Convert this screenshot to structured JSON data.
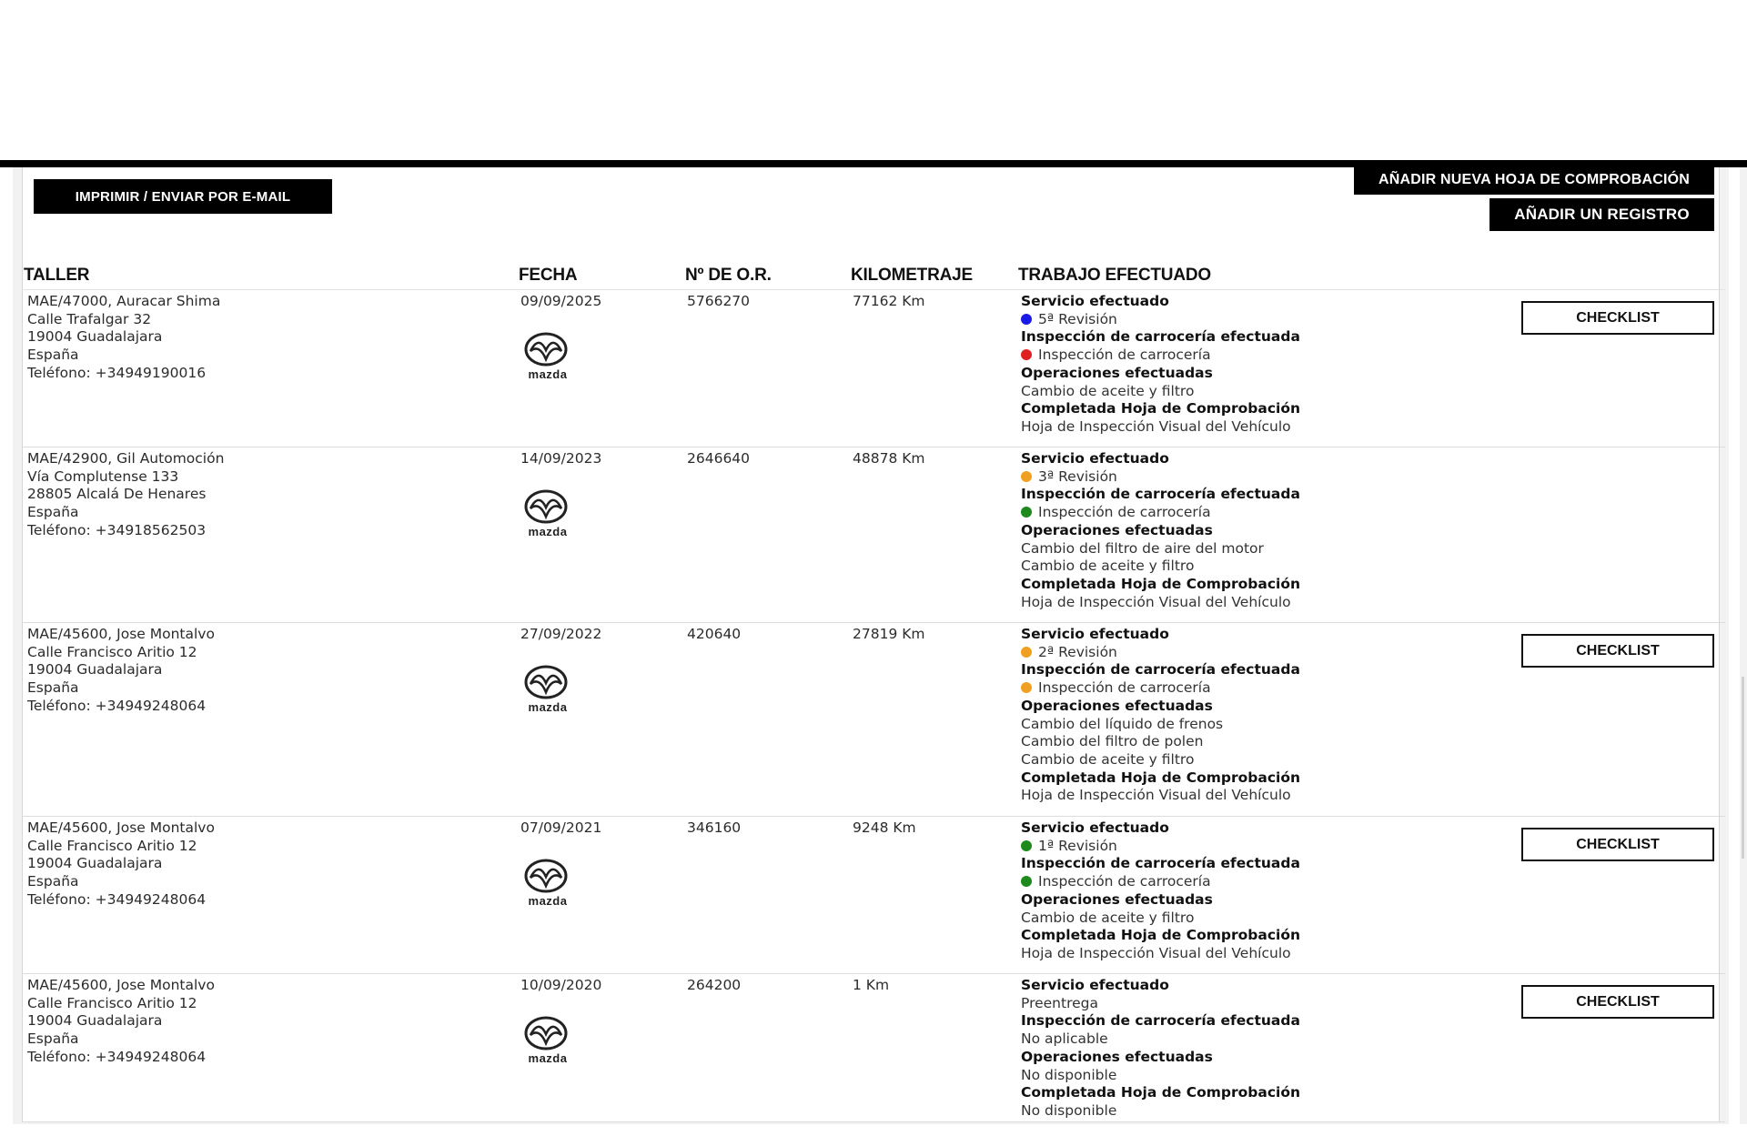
{
  "toolbar": {
    "print_label": "IMPRIMIR / ENVIAR POR E-MAIL",
    "add_sheet_label": "AÑADIR NUEVA HOJA DE COMPROBACIÓN",
    "add_record_label": "AÑADIR UN REGISTRO"
  },
  "columns": {
    "taller": "TALLER",
    "fecha": "FECHA",
    "orden": "Nº DE O.R.",
    "kilometraje": "KILOMETRAJE",
    "trabajo": "TRABAJO EFECTUADO"
  },
  "logo_text": "mazda",
  "checklist_label": "CHECKLIST",
  "colors": {
    "blue": "#1a1ae6",
    "red": "#e02020",
    "orange": "#f0a020",
    "green": "#1e8a1e"
  },
  "records": [
    {
      "taller": [
        "MAE/47000, Auracar Shima",
        "Calle Trafalgar 32",
        "19004 Guadalajara",
        "España",
        "Teléfono: +34949190016"
      ],
      "fecha": "09/09/2025",
      "orden": "5766270",
      "km": "77162 Km",
      "servicio_label": "Servicio efectuado",
      "servicio": "5ª Revisión",
      "servicio_dot": "blue",
      "inspeccion_label": "Inspección de carrocería efectuada",
      "inspeccion": "Inspección de carrocería",
      "inspeccion_dot": "red",
      "operaciones_label": "Operaciones efectuadas",
      "operaciones": [
        "Cambio de aceite y filtro"
      ],
      "hoja_label": "Completada Hoja de Comprobación",
      "hoja": "Hoja de Inspección Visual del Vehículo",
      "checklist": true
    },
    {
      "taller": [
        "MAE/42900, Gil Automoción",
        "Vía Complutense 133",
        "28805 Alcalá De Henares",
        "España",
        "Teléfono: +34918562503"
      ],
      "fecha": "14/09/2023",
      "orden": "2646640",
      "km": "48878 Km",
      "servicio_label": "Servicio efectuado",
      "servicio": "3ª Revisión",
      "servicio_dot": "orange",
      "inspeccion_label": "Inspección de carrocería efectuada",
      "inspeccion": "Inspección de carrocería",
      "inspeccion_dot": "green",
      "operaciones_label": "Operaciones efectuadas",
      "operaciones": [
        "Cambio del filtro de aire del motor",
        "Cambio de aceite y filtro"
      ],
      "hoja_label": "Completada Hoja de Comprobación",
      "hoja": "Hoja de Inspección Visual del Vehículo",
      "checklist": false
    },
    {
      "taller": [
        "MAE/45600, Jose Montalvo",
        "Calle Francisco Aritio 12",
        "19004 Guadalajara",
        "España",
        "Teléfono: +34949248064"
      ],
      "fecha": "27/09/2022",
      "orden": "420640",
      "km": "27819 Km",
      "servicio_label": "Servicio efectuado",
      "servicio": "2ª Revisión",
      "servicio_dot": "orange",
      "inspeccion_label": "Inspección de carrocería efectuada",
      "inspeccion": "Inspección de carrocería",
      "inspeccion_dot": "orange",
      "operaciones_label": "Operaciones efectuadas",
      "operaciones": [
        "Cambio del líquido de frenos",
        "Cambio del filtro de polen",
        "Cambio de aceite y filtro"
      ],
      "hoja_label": "Completada Hoja de Comprobación",
      "hoja": "Hoja de Inspección Visual del Vehículo",
      "checklist": true
    },
    {
      "taller": [
        "MAE/45600, Jose Montalvo",
        "Calle Francisco Aritio 12",
        "19004 Guadalajara",
        "España",
        "Teléfono: +34949248064"
      ],
      "fecha": "07/09/2021",
      "orden": "346160",
      "km": "9248 Km",
      "servicio_label": "Servicio efectuado",
      "servicio": "1ª Revisión",
      "servicio_dot": "green",
      "inspeccion_label": "Inspección de carrocería efectuada",
      "inspeccion": "Inspección de carrocería",
      "inspeccion_dot": "green",
      "operaciones_label": "Operaciones efectuadas",
      "operaciones": [
        "Cambio de aceite y filtro"
      ],
      "hoja_label": "Completada Hoja de Comprobación",
      "hoja": "Hoja de Inspección Visual del Vehículo",
      "checklist": true
    },
    {
      "taller": [
        "MAE/45600, Jose Montalvo",
        "Calle Francisco Aritio 12",
        "19004 Guadalajara",
        "España",
        "Teléfono: +34949248064"
      ],
      "fecha": "10/09/2020",
      "orden": "264200",
      "km": "1 Km",
      "servicio_label": "Servicio efectuado",
      "servicio": "Preentrega",
      "servicio_dot": "",
      "inspeccion_label": "Inspección de carrocería efectuada",
      "inspeccion": "No aplicable",
      "inspeccion_dot": "",
      "operaciones_label": "Operaciones efectuadas",
      "operaciones": [
        "No disponible"
      ],
      "hoja_label": "Completada Hoja de Comprobación",
      "hoja": "No disponible",
      "checklist": true
    }
  ]
}
